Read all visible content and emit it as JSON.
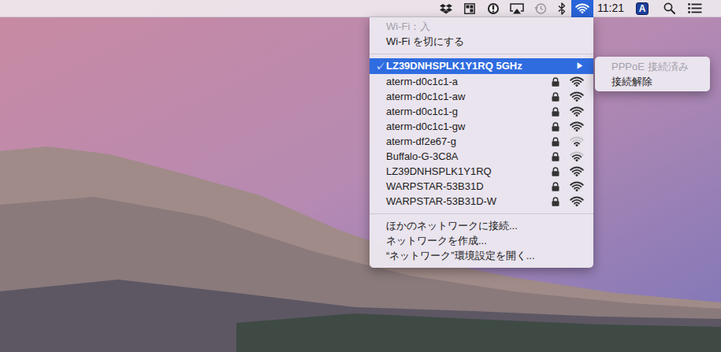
{
  "menu_bar": {
    "wifi_open": true,
    "clock": "11:21",
    "input_source": "A"
  },
  "wifi_menu": {
    "status": {
      "label": "Wi-Fi：入",
      "disabled": true
    },
    "toggle": {
      "label": "Wi-Fi を切にする",
      "disabled": false
    },
    "current": {
      "check": "✓",
      "name": "LZ39DNHSPLK1Y1RQ 5GHz",
      "arrow": "▶",
      "selected": true
    },
    "networks": [
      {
        "name": "aterm-d0c1c1-a",
        "locked": true,
        "level": 1
      },
      {
        "name": "aterm-d0c1c1-aw",
        "locked": true,
        "level": 1
      },
      {
        "name": "aterm-d0c1c1-g",
        "locked": true,
        "level": 1
      },
      {
        "name": "aterm-d0c1c1-gw",
        "locked": true,
        "level": 1
      },
      {
        "name": "aterm-df2e67-g",
        "locked": true,
        "level": 0.33
      },
      {
        "name": "Buffalo-G-3C8A",
        "locked": true,
        "level": 0.67
      },
      {
        "name": "LZ39DNHSPLK1Y1RQ",
        "locked": true,
        "level": 1
      },
      {
        "name": "WARPSTAR-53B31D",
        "locked": true,
        "level": 1
      },
      {
        "name": "WARPSTAR-53B31D-W",
        "locked": true,
        "level": 1
      }
    ],
    "actions": [
      {
        "label": "ほかのネットワークに接続..."
      },
      {
        "label": "ネットワークを作成..."
      },
      {
        "label": "“ネットワーク”環境設定を開く..."
      }
    ]
  },
  "submenu": {
    "items": [
      {
        "label": "PPPoE 接続済み",
        "disabled": true
      },
      {
        "label": "接続解除",
        "disabled": false
      }
    ]
  }
}
